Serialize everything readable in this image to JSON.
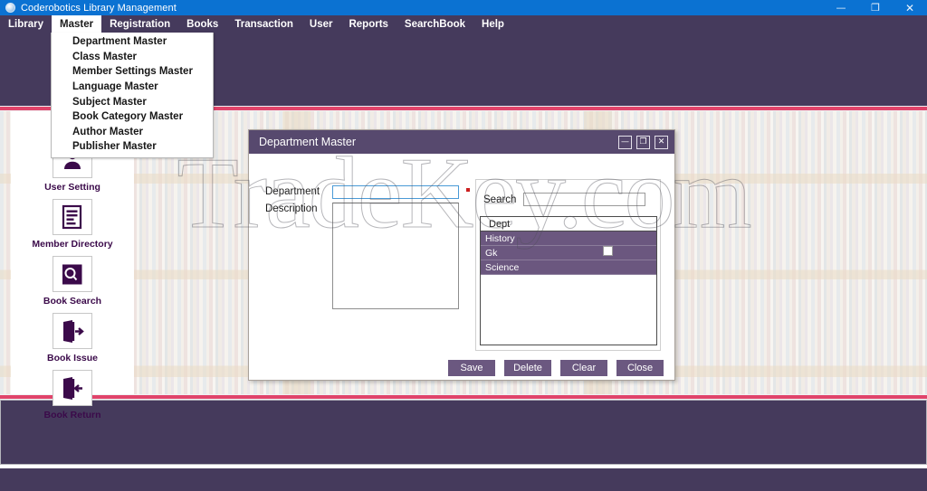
{
  "window": {
    "title": "Coderobotics Library Management",
    "app_icon": "app-circle-icon",
    "controls": {
      "minimize": "—",
      "maximize": "❐",
      "close": "✕"
    }
  },
  "menubar": {
    "items": [
      {
        "label": "Library",
        "active": false
      },
      {
        "label": "Master",
        "active": true
      },
      {
        "label": "Registration",
        "active": false
      },
      {
        "label": "Books",
        "active": false
      },
      {
        "label": "Transaction",
        "active": false
      },
      {
        "label": "User",
        "active": false
      },
      {
        "label": "Reports",
        "active": false
      },
      {
        "label": "SearchBook",
        "active": false
      },
      {
        "label": "Help",
        "active": false
      }
    ]
  },
  "dropdown": {
    "owner": "Master",
    "items": [
      {
        "label": "Department Master"
      },
      {
        "label": "Class Master"
      },
      {
        "label": "Member Settings Master"
      },
      {
        "label": "Language Master"
      },
      {
        "label": "Subject Master"
      },
      {
        "label": "Book Category Master"
      },
      {
        "label": "Author Master"
      },
      {
        "label": "Publisher Master"
      }
    ]
  },
  "sidebar": {
    "items": [
      {
        "label": "User Setting",
        "icon": "user-setting-icon"
      },
      {
        "label": "Member Directory",
        "icon": "document-lines-icon"
      },
      {
        "label": "Book Search",
        "icon": "book-magnifier-icon"
      },
      {
        "label": "Book Issue",
        "icon": "door-arrow-out-icon"
      },
      {
        "label": "Book Return",
        "icon": "door-arrow-in-icon"
      }
    ]
  },
  "dialog": {
    "title": "Department Master",
    "controls": {
      "minimize": "—",
      "maximize": "❐",
      "close": "✕"
    },
    "fields": {
      "department": {
        "label": "Department",
        "value": "",
        "placeholder": "",
        "required": true
      },
      "description": {
        "label": "Description",
        "value": "",
        "placeholder": ""
      }
    },
    "search": {
      "label": "Search",
      "value": "",
      "placeholder": ""
    },
    "grid": {
      "columns": [
        "Dept"
      ],
      "rows": [
        {
          "Dept": "History"
        },
        {
          "Dept": "Gk"
        },
        {
          "Dept": "Science"
        }
      ]
    },
    "actions": [
      {
        "label": "Save"
      },
      {
        "label": "Delete"
      },
      {
        "label": "Clear"
      },
      {
        "label": "Close"
      }
    ]
  },
  "watermark": {
    "text": "TradeKey.com"
  },
  "colors": {
    "os_titlebar": "#0b72d2",
    "menu_purple": "#453a5c",
    "accent_pink": "#e0436a",
    "dialog_header": "#57496e",
    "grid_row": "#6b577f",
    "button_purple": "#6b5880",
    "required_red": "#cc1f1f",
    "focus_blue": "#4a9ad6"
  }
}
